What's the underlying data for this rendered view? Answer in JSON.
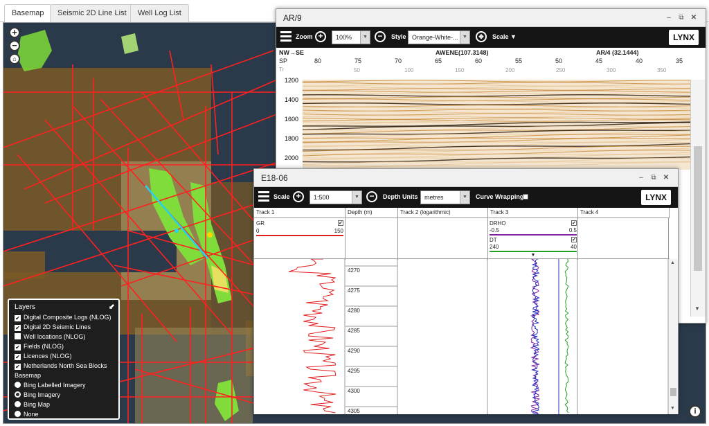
{
  "tabs": [
    {
      "label": "Basemap",
      "active": true
    },
    {
      "label": "Seismic 2D Line List",
      "active": false
    },
    {
      "label": "Well Log List",
      "active": false
    }
  ],
  "seismic": {
    "title": "AR/9",
    "zoom_label": "Zoom",
    "zoom_value": "100%",
    "style_label": "Style",
    "style_value": "Orange-White-...",
    "scale_label": "Scale ▼",
    "logo": "LYNX",
    "direction": "NW→SE",
    "sp_label": "SP",
    "tr_label": "Tr",
    "crossing": "AWENE(107.3148)",
    "crossing2": "AR/4 (32.1444)",
    "sp_ticks": [
      "80",
      "75",
      "70",
      "65",
      "60",
      "55",
      "50",
      "45",
      "40",
      "35"
    ],
    "tr_ticks": [
      "50",
      "100",
      "150",
      "200",
      "250",
      "300",
      "350"
    ],
    "depths": [
      "1200",
      "1400",
      "1600",
      "1800",
      "2000"
    ]
  },
  "welllog": {
    "title": "E18-06",
    "scale_label": "Scale",
    "scale_value": "1:500",
    "depth_units_label": "Depth Units",
    "depth_units_value": "metres",
    "curve_wrapping_label": "Curve Wrapping",
    "logo": "LYNX",
    "tracks": [
      "Track 1",
      "Depth (m)",
      "Track 2 (logarithmic)",
      "Track 3",
      "Track 4"
    ],
    "curves": {
      "gr": {
        "name": "GR",
        "min": "0",
        "max": "150",
        "color": "#e02020"
      },
      "drho": {
        "name": "DRHO",
        "min": "-0.5",
        "max": "0.5",
        "color": "#8020a0"
      },
      "dt": {
        "name": "DT",
        "min": "240",
        "max": "40",
        "color": "#20a020"
      }
    },
    "depths": [
      "4270",
      "4275",
      "4280",
      "4285",
      "4290",
      "4295",
      "4300",
      "4305"
    ]
  },
  "layers": {
    "title": "Layers",
    "items": [
      {
        "label": "Digital Composite Logs (NLOG)",
        "checked": true
      },
      {
        "label": "Digital 2D Seismic Lines",
        "checked": true
      },
      {
        "label": "Well locations (NLOG)",
        "checked": false
      },
      {
        "label": "Fields (NLOG)",
        "checked": true
      },
      {
        "label": "Licences (NLOG)",
        "checked": true
      },
      {
        "label": "Netherlands North Sea Blocks",
        "checked": true
      }
    ],
    "basemap_title": "Basemap",
    "basemaps": [
      {
        "label": "Bing Labelled Imagery",
        "selected": false
      },
      {
        "label": "Bing Imagery",
        "selected": true
      },
      {
        "label": "Bing Map",
        "selected": false
      },
      {
        "label": "None",
        "selected": false
      }
    ]
  },
  "colors": {
    "seismic_line": "#ff2020",
    "selected_line": "#22d3ee",
    "field": "#7fdc3a",
    "licence": "#8a6a2a"
  }
}
